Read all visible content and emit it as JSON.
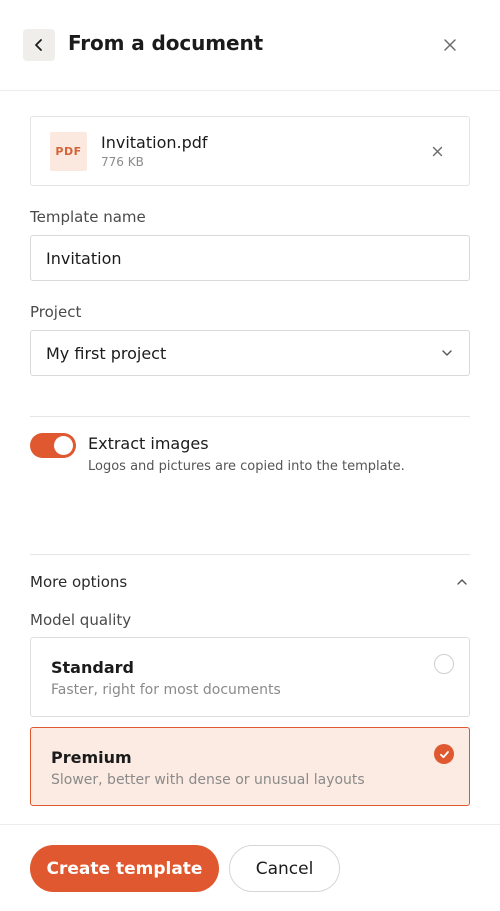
{
  "header": {
    "title": "From a document"
  },
  "file": {
    "type_badge": "PDF",
    "name": "Invitation.pdf",
    "size": "776 KB"
  },
  "template_name": {
    "label": "Template name",
    "value": "Invitation"
  },
  "project": {
    "label": "Project",
    "selected": "My first project"
  },
  "extract_images": {
    "title": "Extract images",
    "description": "Logos and pictures are copied into the template.",
    "enabled": true
  },
  "more_options": {
    "label": "More options",
    "expanded": true
  },
  "model_quality": {
    "label": "Model quality",
    "options": [
      {
        "title": "Standard",
        "description": "Faster, right for most documents",
        "selected": false
      },
      {
        "title": "Premium",
        "description": "Slower, better with dense or unusual layouts",
        "selected": true
      }
    ]
  },
  "footer": {
    "create_label": "Create template",
    "cancel_label": "Cancel"
  },
  "colors": {
    "accent": "#e0582f",
    "accent_soft": "#fcebe3",
    "pdf_badge_bg": "#fbe9df"
  },
  "icons": {
    "back": "chevron-left-icon",
    "close": "close-icon",
    "file_remove": "close-icon",
    "select": "chevron-down-icon",
    "collapse": "chevron-up-icon",
    "check": "check-icon"
  }
}
